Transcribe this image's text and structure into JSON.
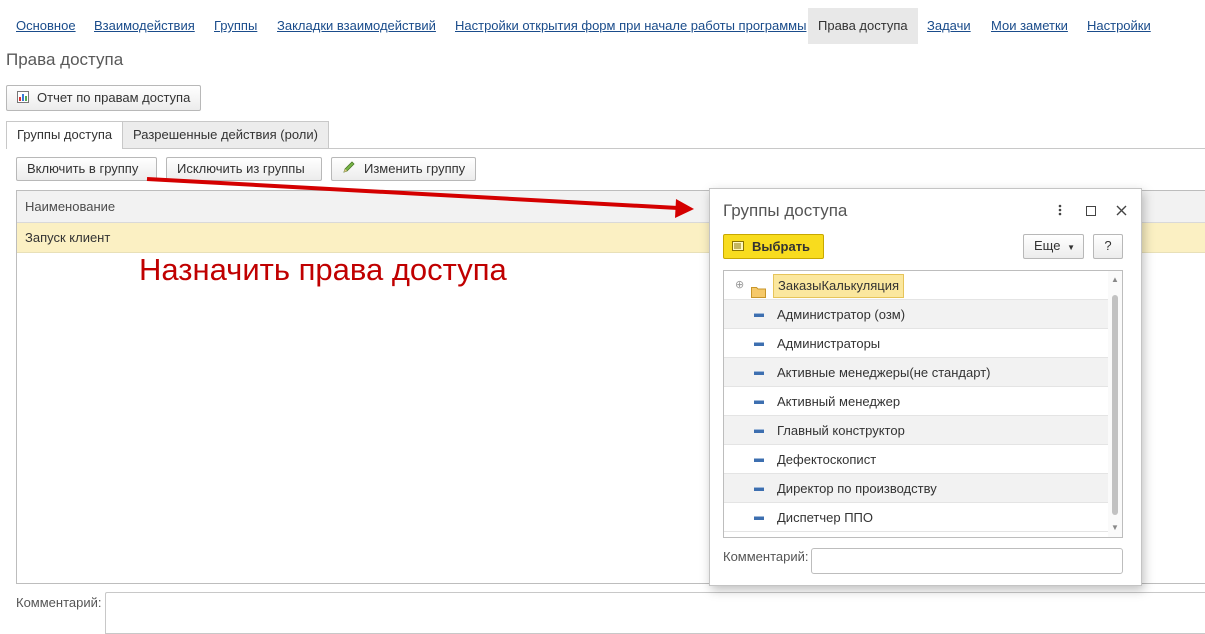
{
  "topnav": {
    "items": [
      {
        "label": "Основное"
      },
      {
        "label": "Взаимодействия"
      },
      {
        "label": "Группы"
      },
      {
        "label": "Закладки взаимодействий"
      },
      {
        "label": "Настройки открытия форм при начале работы программы"
      },
      {
        "label": "Права доступа"
      },
      {
        "label": "Задачи"
      },
      {
        "label": "Мои заметки"
      },
      {
        "label": "Настройки"
      }
    ],
    "active": "Права доступа"
  },
  "page": {
    "title": "Права доступа",
    "report_button": "Отчет по правам доступа"
  },
  "tabs": [
    {
      "label": "Группы доступа"
    },
    {
      "label": "Разрешенные действия (роли)"
    }
  ],
  "toolbar": {
    "include_label": "Включить в группу",
    "exclude_label": "Исключить из группы",
    "edit_label": "Изменить группу"
  },
  "grid": {
    "header": "Наименование",
    "rows": [
      "Запуск клиент"
    ]
  },
  "annotation": {
    "text": "Назначить права доступа",
    "color": "#c00000"
  },
  "comment": {
    "label": "Комментарий:"
  },
  "dialog": {
    "title": "Группы доступа",
    "select_label": "Выбрать",
    "more_label": "Еще",
    "help_label": "?",
    "folder": "ЗаказыКалькуляция",
    "items": [
      "Администратор (озм)",
      "Администраторы",
      "Активные менеджеры(не стандарт)",
      "Активный менеджер",
      "Главный конструктор",
      "Дефектоскопист",
      "Директор по производству",
      "Диспетчер ППО"
    ],
    "comment_label": "Комментарий:"
  },
  "colors": {
    "link": "#1a4c8b",
    "select_button": "#f8dc1e",
    "selected_row": "#fbf0c3"
  }
}
